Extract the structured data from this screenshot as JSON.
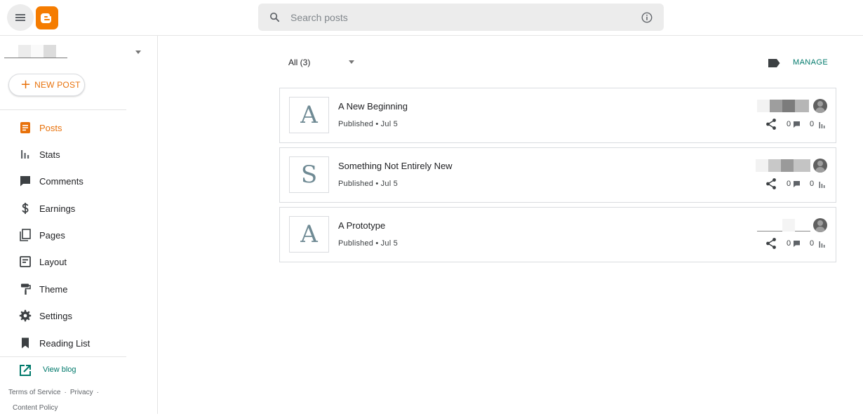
{
  "header": {
    "search_placeholder": "Search posts",
    "icons": [
      "menu-icon",
      "blogger-logo",
      "search-icon",
      "info-icon"
    ]
  },
  "sidebar": {
    "new_post_label": "NEW POST",
    "items": [
      {
        "label": "Posts",
        "icon": "posts-icon",
        "active": true
      },
      {
        "label": "Stats",
        "icon": "stats-icon",
        "active": false
      },
      {
        "label": "Comments",
        "icon": "comment-icon",
        "active": false
      },
      {
        "label": "Earnings",
        "icon": "dollar-icon",
        "active": false
      },
      {
        "label": "Pages",
        "icon": "pages-icon",
        "active": false
      },
      {
        "label": "Layout",
        "icon": "layout-icon",
        "active": false
      },
      {
        "label": "Theme",
        "icon": "paint-roller-icon",
        "active": false
      },
      {
        "label": "Settings",
        "icon": "gear-icon",
        "active": false
      },
      {
        "label": "Reading List",
        "icon": "bookmark-icon",
        "active": false
      }
    ],
    "view_blog": "View blog",
    "footer": {
      "terms": "Terms of Service",
      "privacy": "Privacy",
      "content_policy": "Content Policy"
    }
  },
  "main": {
    "filter_label": "All (3)",
    "manage_label": "MANAGE",
    "posts": [
      {
        "thumb": "A",
        "title": "A New Beginning",
        "meta": "Published • Jul 5",
        "comments": "0",
        "views": "0"
      },
      {
        "thumb": "S",
        "title": "Something Not Entirely New",
        "meta": "Published • Jul 5",
        "comments": "0",
        "views": "0"
      },
      {
        "thumb": "A",
        "title": "A Prototype",
        "meta": "Published • Jul 5",
        "comments": "0",
        "views": "0"
      }
    ]
  },
  "colors": {
    "accent": "#e8710a",
    "link": "#00796b",
    "logo": "#f57c00"
  }
}
